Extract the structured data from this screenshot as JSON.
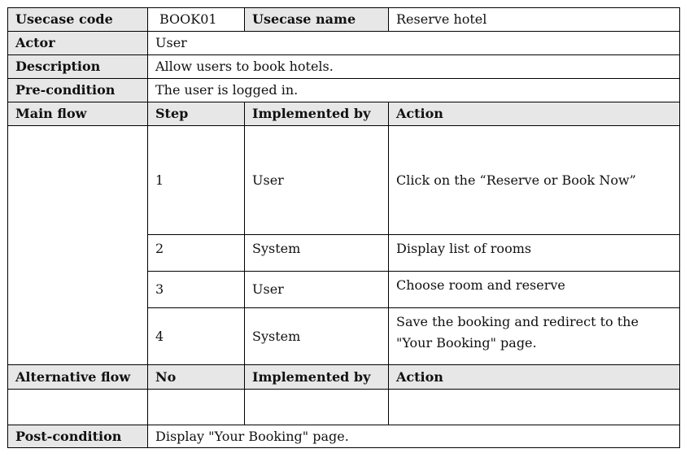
{
  "header": {
    "usecase_code_label": "Usecase code",
    "usecase_code": "BOOK01",
    "usecase_name_label": "Usecase name",
    "usecase_name": "Reserve hotel"
  },
  "actor": {
    "label": "Actor",
    "value": "User"
  },
  "description": {
    "label": "Description",
    "value": "Allow users to book hotels."
  },
  "precondition": {
    "label": "Pre-condition",
    "value": "The user is logged in."
  },
  "main_flow": {
    "label": "Main flow",
    "columns": [
      "Step",
      "Implemented by",
      "Action"
    ],
    "steps": [
      {
        "step": "1",
        "by": "User",
        "action": "Click on the “Reserve or Book Now”"
      },
      {
        "step": "2",
        "by": "System",
        "action": "Display list of rooms"
      },
      {
        "step": "3",
        "by": "User",
        "action": "Choose room and reserve"
      },
      {
        "step": "4",
        "by": "System",
        "action": "Save the booking and redirect to the \"Your Booking\" page."
      }
    ]
  },
  "alt_flow": {
    "label": "Alternative flow",
    "columns": [
      "No",
      "Implemented by",
      "Action"
    ]
  },
  "postcondition": {
    "label": "Post-condition",
    "value": "Display \"Your Booking\" page."
  }
}
